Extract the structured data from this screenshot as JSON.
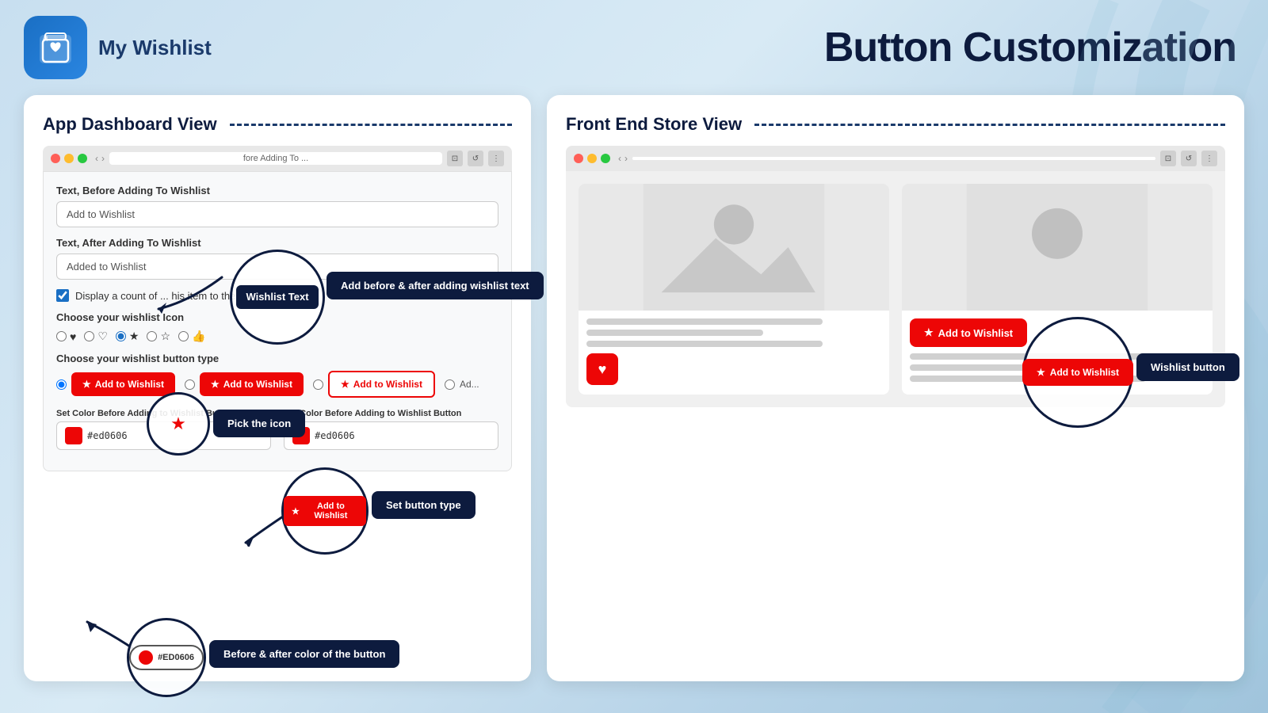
{
  "header": {
    "app_name": "My Wishlist",
    "page_title": "Button Customization"
  },
  "dashboard": {
    "title": "App Dashboard View",
    "browser": {
      "url": "fore Adding To ...",
      "icons": [
        "⊡",
        "⊡",
        "⊡"
      ]
    },
    "form": {
      "text_before_label": "Text, Before Adding To Wishlist",
      "text_before_value": "Add to Wishlist",
      "text_after_label": "Text, After Adding To Wishlist",
      "text_after_value": "Added to Wishlist",
      "checkbox_label": "Display a count of ... his item to their Wishlist",
      "icon_label": "Choose your wishlist Icon",
      "button_type_label": "Choose your wishlist button type",
      "color_before_label": "Set Color Before Adding to Wishlist Button",
      "color_before_value": "#ed0606",
      "color_after_label": "Set Color Before Adding to Wishlist Button",
      "color_after_value": "#ed0606"
    }
  },
  "annotations": {
    "wishlist_text_tooltip": "Add before & after adding wishlist text",
    "wishlist_text_badge": "Wishlist Text",
    "pick_icon_tooltip": "Pick the icon",
    "set_button_type_tooltip": "Set button type",
    "color_tooltip": "Before & after color of the button",
    "color_hex": "#ED0606",
    "store_wishlist_button_label": "Wishlist button"
  },
  "store": {
    "title": "Front End Store View",
    "wishlist_btn_text": "Add to Wishlist",
    "wishlist_label": "Wishlist button"
  },
  "buttons": {
    "add_to_wishlist": "Add to Wishlist",
    "added_to_wishlist": "Added to Wishlist"
  }
}
